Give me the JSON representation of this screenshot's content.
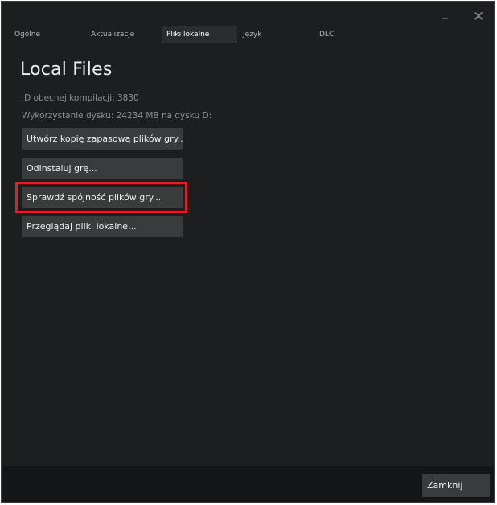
{
  "window": {
    "minimize_glyph": "_",
    "close_glyph": "✕"
  },
  "tabs": [
    {
      "label": "Ogólne"
    },
    {
      "label": "Aktualizacje"
    },
    {
      "label": "Pliki lokalne"
    },
    {
      "label": "Język"
    },
    {
      "label": "DLC"
    }
  ],
  "active_tab": "Pliki lokalne",
  "page": {
    "title": "Local Files",
    "build_id": "ID obecnej kompilacji: 3830",
    "disk_usage": "Wykorzystanie dysku: 24234 MB na dysku D:"
  },
  "actions": {
    "backup": "Utwórz kopię zapasową plików gry...",
    "uninstall": "Odinstaluj grę...",
    "verify": "Sprawdź spójność plików gry...",
    "browse": "Przeglądaj pliki lokalne..."
  },
  "highlight": {
    "color": "#d9232c",
    "target": "verify"
  },
  "footer": {
    "close_label": "Zamknij"
  },
  "colors": {
    "background": "#1d1e20",
    "button": "#3a3b3d",
    "footer": "#141517",
    "active_tab_underline": "#7aa9c9"
  }
}
